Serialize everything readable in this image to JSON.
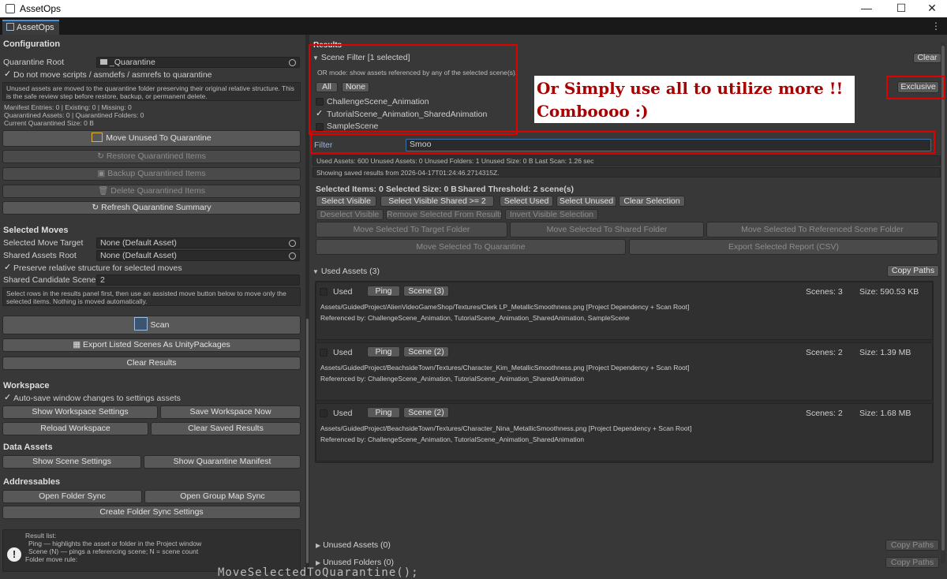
{
  "window": {
    "title": "AssetOps",
    "minimize": "—",
    "maximize": "☐",
    "close": "✕"
  },
  "tab": {
    "label": "AssetOps",
    "more": "⋮"
  },
  "left": {
    "configuration_header": "Configuration",
    "quarantine_root_label": "Quarantine Root",
    "quarantine_root_value": "_Quarantine",
    "no_move_scripts_label": "Do not move scripts / asmdefs / asmrefs to quarantine",
    "quarantine_help": "Unused assets are moved to the quarantine folder preserving their original relative structure. This is the safe review step before restore, backup, or permanent delete.",
    "summary": [
      "Manifest Entries: 0 | Existing: 0 | Missing: 0",
      "Quarantined Assets: 0 | Quarantined Folders: 0",
      "Current Quarantined Size: 0 B"
    ],
    "move_unused_button": "Move Unused To Quarantine",
    "restore_button": "Restore Quarantined Items",
    "backup_button": "Backup Quarantined Items",
    "delete_button": "Delete Quarantined Items",
    "refresh_button": "Refresh Quarantine Summary",
    "selected_moves_header": "Selected Moves",
    "selected_move_target_label": "Selected Move Target",
    "selected_move_target_value": "None (Default Asset)",
    "shared_assets_root_label": "Shared Assets Root",
    "shared_assets_root_value": "None (Default Asset)",
    "preserve_structure_label": "Preserve relative structure for selected moves",
    "shared_candidate_label": "Shared Candidate Scene C",
    "shared_candidate_value": "2",
    "selected_moves_help": "Select rows in the results panel first, then use an assisted move button below to move only the selected items. Nothing is moved automatically.",
    "scan_button": "Scan",
    "export_scenes_button": "Export Listed Scenes As UnityPackages",
    "clear_results_button": "Clear Results",
    "workspace_header": "Workspace",
    "autosave_label": "Auto-save window changes to settings assets",
    "show_workspace_settings_button": "Show Workspace Settings",
    "save_workspace_button": "Save Workspace Now",
    "reload_workspace_button": "Reload Workspace",
    "clear_saved_results_button": "Clear Saved Results",
    "data_assets_header": "Data Assets",
    "show_scene_settings_button": "Show Scene Settings",
    "show_quarantine_manifest_button": "Show Quarantine Manifest",
    "addressables_header": "Addressables",
    "open_folder_sync_button": "Open Folder Sync",
    "open_group_map_sync_button": "Open Group Map Sync",
    "create_folder_sync_button": "Create Folder Sync Settings",
    "result_list_help": [
      "Result list:",
      "Ping — highlights the asset or folder in the Project window",
      "Scene (N) — pings a referencing scene; N = scene count",
      "",
      "Folder move rule:"
    ]
  },
  "right": {
    "results_header": "Results",
    "scene_filter_label": "Scene Filter  [1 selected]",
    "clear_button": "Clear",
    "or_mode_text": "OR mode: show assets referenced by any of the selected scene(s).",
    "all_button": "All",
    "none_button": "None",
    "scenes": [
      {
        "name": "ChallengeScene_Animation",
        "checked": false
      },
      {
        "name": "TutorialScene_Animation_SharedAnimation",
        "checked": true
      },
      {
        "name": "SampleScene",
        "checked": false
      }
    ],
    "exclusive_button": "Exclusive",
    "annotation": [
      "Or Simply use all to utilize more !!",
      "Comboooo :)"
    ],
    "filter_label": "Filter",
    "filter_value": "Smoo",
    "stats": "Used Assets: 600    Unused Assets: 0    Unused Folders: 1    Unused Size: 0 B    Last Scan: 1.26 sec",
    "saved_results": "Showing saved results from 2026-04-17T01:24:46.2714315Z.",
    "selected_items": "Selected Items: 0",
    "selected_size": "Selected Size: 0 B",
    "shared_threshold": "Shared Threshold: 2 scene(s)",
    "select_visible": "Select Visible",
    "select_visible_shared": "Select Visible Shared >= 2",
    "select_used": "Select Used",
    "select_unused": "Select Unused",
    "clear_selection": "Clear Selection",
    "deselect_visible": "Deselect Visible",
    "remove_selected": "Remove Selected From Results",
    "invert_visible": "Invert Visible Selection",
    "move_to_target": "Move Selected To Target Folder",
    "move_to_shared": "Move Selected To Shared Folder",
    "move_to_referenced": "Move Selected To Referenced Scene Folder",
    "move_to_quarantine": "Move Selected To Quarantine",
    "export_report": "Export Selected Report (CSV)",
    "used_assets_header": "Used Assets (3)",
    "copy_paths": "Copy Paths",
    "assets": [
      {
        "tag": "Used",
        "ping": "Ping",
        "scene": "Scene (3)",
        "scenes": "Scenes: 3",
        "size": "Size: 590.53 KB",
        "path": "Assets/GuidedProject/AlienVideoGameShop/Textures/Clerk LP_MetallicSmoothness.png     [Project Dependency + Scan Root]",
        "refs": "Referenced by: ChallengeScene_Animation, TutorialScene_Animation_SharedAnimation, SampleScene"
      },
      {
        "tag": "Used",
        "ping": "Ping",
        "scene": "Scene (2)",
        "scenes": "Scenes: 2",
        "size": "Size: 1.39 MB",
        "path": "Assets/GuidedProject/BeachsideTown/Textures/Character_Kim_MetallicSmoothness.png     [Project Dependency + Scan Root]",
        "refs": "Referenced by: ChallengeScene_Animation, TutorialScene_Animation_SharedAnimation"
      },
      {
        "tag": "Used",
        "ping": "Ping",
        "scene": "Scene (2)",
        "scenes": "Scenes: 2",
        "size": "Size: 1.68 MB",
        "path": "Assets/GuidedProject/BeachsideTown/Textures/Character_Nina_MetallicSmoothness.png     [Project Dependency + Scan Root]",
        "refs": "Referenced by: ChallengeScene_Animation, TutorialScene_Animation_SharedAnimation"
      }
    ],
    "unused_assets_header": "Unused Assets (0)",
    "unused_folders_header": "Unused Folders (0)"
  },
  "bottom_code": "MoveSelectedToQuarantine();"
}
